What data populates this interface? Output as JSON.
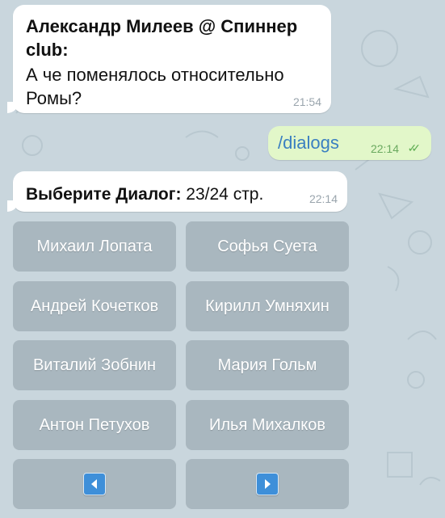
{
  "messages": {
    "incoming1": {
      "sender": "Александр Милеев @ Спиннер club:",
      "text": "А че поменялось относительно Ромы?",
      "time": "21:54"
    },
    "outgoing1": {
      "text": "/dialogs",
      "time": "22:14",
      "status_icon": "double-check-icon"
    },
    "incoming2": {
      "bold": "Выберите Диалог:",
      "text": " 23/24 стр.",
      "time": "22:14"
    }
  },
  "keyboard": {
    "buttons": [
      [
        "Михаил Лопата",
        "Софья Суета"
      ],
      [
        "Андрей Кочетков",
        "Кирилл Умняхин"
      ],
      [
        "Виталий Зобнин",
        "Мария Гольм"
      ],
      [
        "Антон Петухов",
        "Илья Михалков"
      ]
    ],
    "nav": [
      "left-arrow-icon",
      "right-arrow-icon"
    ]
  },
  "colors": {
    "background": "#c9d6dd",
    "outgoing_bubble": "#e2f7c9",
    "check_marks": "#5fae53",
    "nav_icon": "#3e8fd9"
  }
}
